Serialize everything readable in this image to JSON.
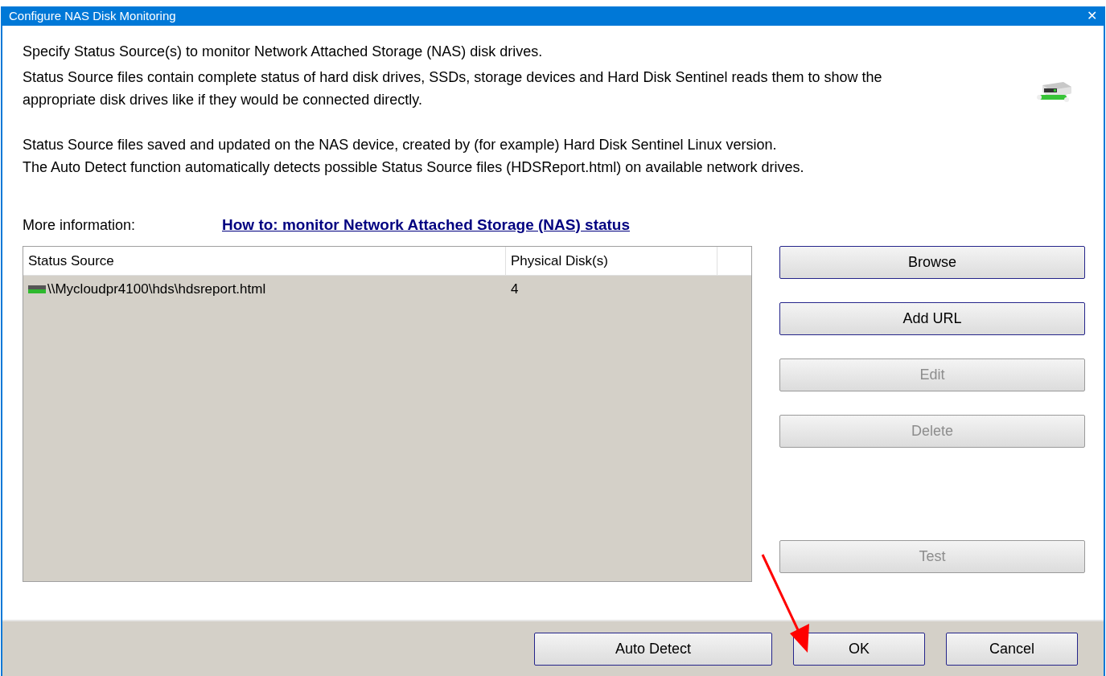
{
  "window": {
    "title": "Configure NAS Disk Monitoring",
    "close": "✕"
  },
  "description": [
    [
      "Specify Status Source(s) to monitor Network Attached Storage (NAS) disk drives.",
      "Status Source files contain complete status of hard disk drives, SSDs, storage devices and Hard Disk Sentinel reads them to show the appropriate disk drives like if they would be connected directly."
    ],
    [
      "Status Source files saved and updated on the NAS device, created by (for example) Hard Disk Sentinel Linux version.",
      "The Auto Detect function automatically detects possible Status Source files (HDSReport.html) on available network drives."
    ]
  ],
  "more_info": {
    "label": "More information:",
    "link": "How to: monitor Network Attached Storage (NAS) status"
  },
  "table": {
    "columns": [
      "Status Source",
      "Physical Disk(s)"
    ],
    "rows": [
      {
        "cells": [
          "\\\\Mycloudpr4100\\hds\\hdsreport.html",
          "4"
        ],
        "selected": false
      }
    ]
  },
  "side_buttons": [
    {
      "label": "Browse",
      "disabled": false
    },
    {
      "label": "Add URL",
      "disabled": false
    },
    {
      "label": "Edit",
      "disabled": true
    },
    {
      "label": "Delete",
      "disabled": true
    },
    {
      "label": "Test",
      "disabled": true
    }
  ],
  "footer_buttons": [
    {
      "label": "Auto Detect",
      "disabled": false
    },
    {
      "label": "OK",
      "disabled": false
    },
    {
      "label": "Cancel",
      "disabled": false
    }
  ]
}
